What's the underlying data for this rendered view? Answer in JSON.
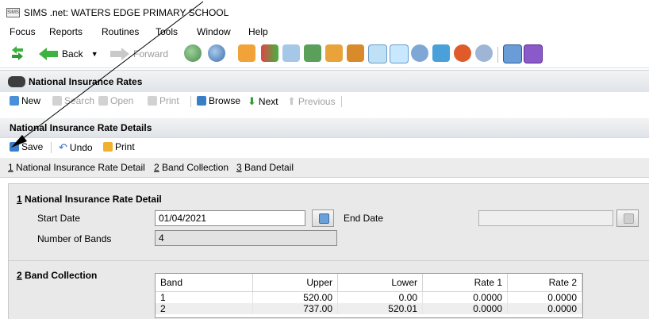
{
  "window": {
    "app_icon_text": "SIMS",
    "title": "SIMS .net: WATERS EDGE PRIMARY SCHOOL"
  },
  "menu": [
    {
      "label": "Focus"
    },
    {
      "label": "Reports"
    },
    {
      "label": "Routines"
    },
    {
      "label": "Tools"
    },
    {
      "label": "Window"
    },
    {
      "label": "Help"
    }
  ],
  "toolbar": {
    "back_label": "Back",
    "forward_label": "Forward"
  },
  "colors": {
    "section_header": "#dfe3e8",
    "link_bar": "#ececec",
    "panel": "#e9e9e9",
    "grid_alt_row": "#eeeeee"
  },
  "section": {
    "title": "National Insurance Rates",
    "buttons": {
      "new": "New",
      "search": "Search",
      "open": "Open",
      "print": "Print",
      "browse": "Browse",
      "next": "Next",
      "previous": "Previous"
    }
  },
  "details": {
    "title": "National Insurance Rate Details",
    "buttons": {
      "save": "Save",
      "undo": "Undo",
      "print": "Print"
    },
    "links": [
      {
        "num": "1",
        "label": " National Insurance Rate Detail"
      },
      {
        "num": "2",
        "label": " Band Collection"
      },
      {
        "num": "3",
        "label": " Band Detail"
      }
    ]
  },
  "rate_detail": {
    "heading_num": "1",
    "heading": " National Insurance Rate Detail",
    "start_date_label": "Start Date",
    "start_date": "01/04/2021",
    "end_date_label": "End Date",
    "end_date": "",
    "num_bands_label": "Number of Bands",
    "num_bands": "4"
  },
  "band_collection": {
    "heading_num": "2",
    "heading": " Band Collection",
    "columns": [
      "Band",
      "Upper",
      "Lower",
      "Rate 1",
      "Rate 2"
    ],
    "rows": [
      [
        "1",
        "520.00",
        "0.00",
        "0.0000",
        "0.0000"
      ],
      [
        "2",
        "737.00",
        "520.01",
        "0.0000",
        "0.0000"
      ]
    ]
  }
}
